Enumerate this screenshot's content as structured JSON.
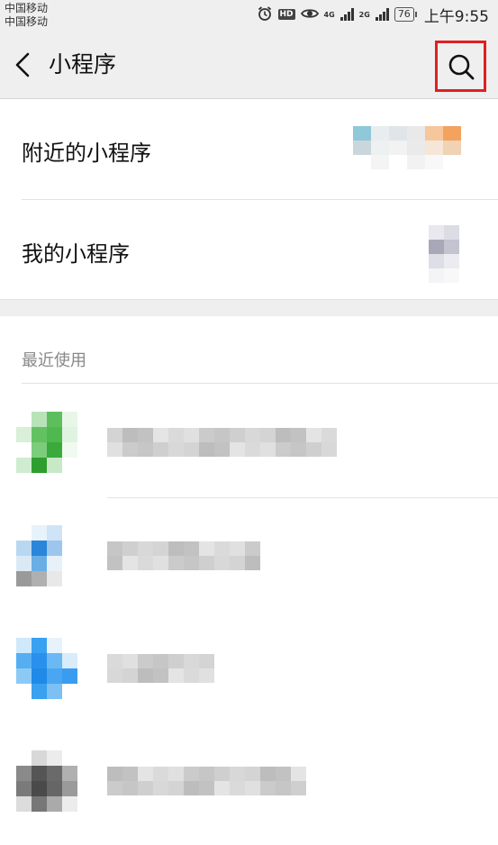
{
  "status_bar": {
    "carrier_1": "中国移动",
    "carrier_2": "中国移动",
    "hd_badge": "HD",
    "net_1": "4G",
    "net_2": "2G",
    "battery": "76",
    "time": "上午9:55",
    "icons": [
      "alarm-icon",
      "hd-icon",
      "eye-icon",
      "signal-4g-icon",
      "signal-2g-icon",
      "battery-icon"
    ]
  },
  "nav": {
    "title": "小程序",
    "back_icon": "chevron-left-icon",
    "search_icon": "search-icon",
    "highlight_color": "#e02020"
  },
  "menu": {
    "nearby_label": "附近的小程序",
    "mine_label": "我的小程序"
  },
  "recent": {
    "section_title": "最近使用",
    "items": [
      {
        "icon": "mini-program-icon-green",
        "name": "",
        "accent": "#5cbf5c"
      },
      {
        "icon": "mini-program-icon-blue",
        "name": "",
        "accent": "#2a86d8"
      },
      {
        "icon": "mini-program-icon-lightblue",
        "name": "",
        "accent": "#3aa0f0"
      },
      {
        "icon": "mini-program-icon-gray",
        "name": "",
        "accent": "#555555"
      }
    ]
  }
}
